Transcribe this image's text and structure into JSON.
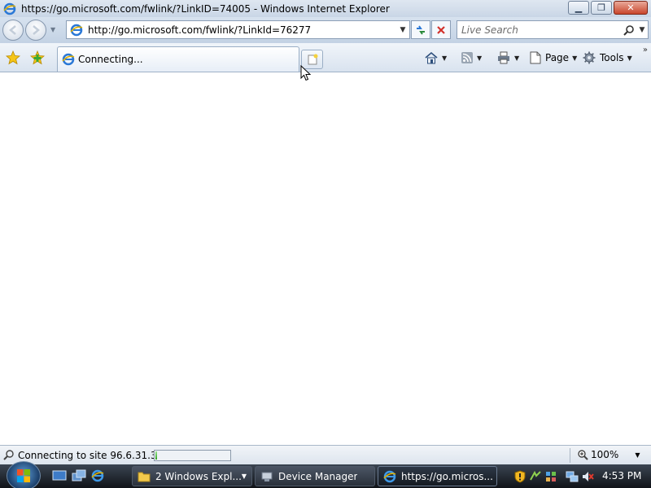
{
  "window": {
    "title": "https://go.microsoft.com/fwlink/?LinkID=74005 - Windows Internet Explorer",
    "minimize_label": "▁",
    "restore_label": "❐",
    "close_label": "✕"
  },
  "address_bar": {
    "url": "http://go.microsoft.com/fwlink/?LinkId=76277"
  },
  "search": {
    "placeholder": "Live Search"
  },
  "tab": {
    "label": "Connecting..."
  },
  "command_bar": {
    "page_label": "Page",
    "tools_label": "Tools"
  },
  "status": {
    "text": "Connecting to site 96.6.31.32",
    "progress": 0.02,
    "zoom": "100%"
  },
  "taskbar": {
    "tasks": [
      {
        "label": "2 Windows Expl...",
        "icon": "folder-icon"
      },
      {
        "label": "Device Manager",
        "icon": "device-manager-icon"
      },
      {
        "label": "https://go.micros...",
        "icon": "ie-icon"
      }
    ],
    "clock": "4:53 PM"
  },
  "colors": {
    "accent": "#1a5fb4",
    "ie_blue": "#2a78d6",
    "close_red": "#c9462c"
  }
}
